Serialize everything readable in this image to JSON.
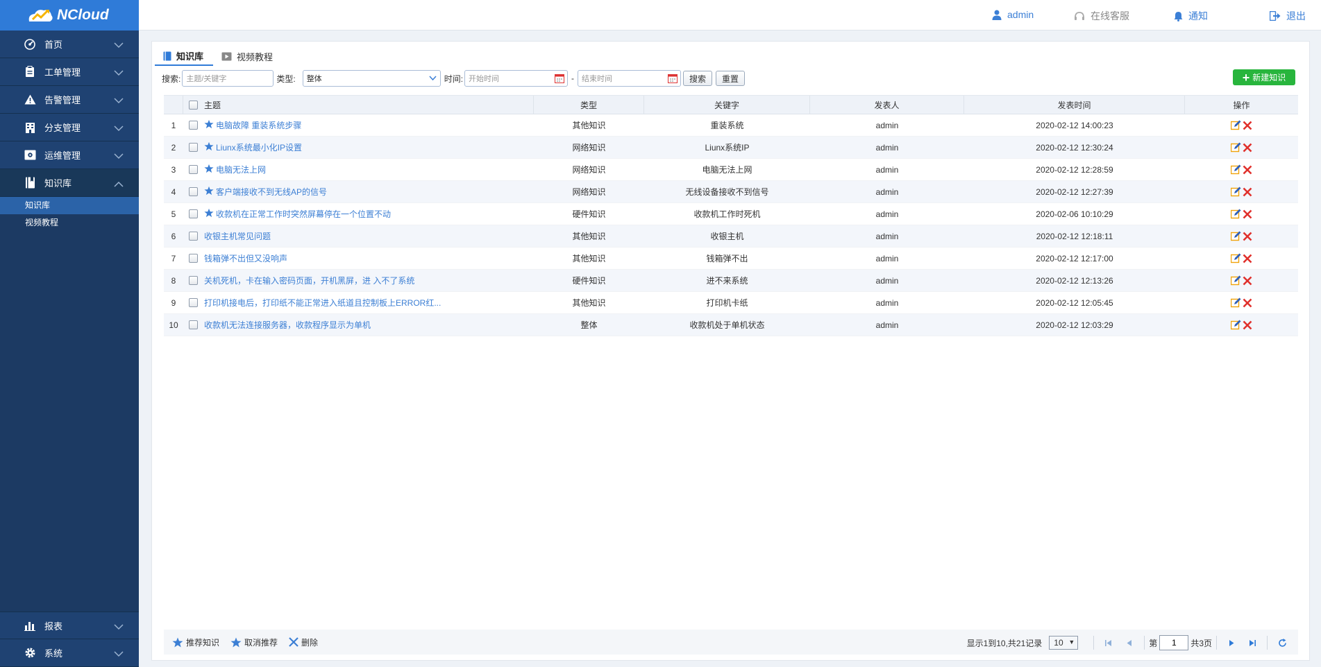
{
  "app": {
    "name": "NCloud"
  },
  "sidebar": {
    "items": [
      {
        "label": "首页",
        "icon": "dashboard-icon"
      },
      {
        "label": "工单管理",
        "icon": "clipboard-icon"
      },
      {
        "label": "告警管理",
        "icon": "warning-icon"
      },
      {
        "label": "分支管理",
        "icon": "building-icon"
      },
      {
        "label": "运维管理",
        "icon": "monitor-icon"
      },
      {
        "label": "知识库",
        "icon": "book-icon",
        "expanded": true
      }
    ],
    "sub_items": [
      {
        "label": "知识库",
        "active": true
      },
      {
        "label": "视频教程",
        "active": false
      }
    ],
    "bottom_items": [
      {
        "label": "报表",
        "icon": "chart-icon"
      },
      {
        "label": "系统",
        "icon": "gear-icon"
      }
    ]
  },
  "topbar": {
    "user": "admin",
    "support": "在线客服",
    "notify": "通知",
    "logout": "退出"
  },
  "tabs": [
    {
      "label": "知识库",
      "active": true
    },
    {
      "label": "视频教程",
      "active": false
    }
  ],
  "filters": {
    "search_label": "搜索:",
    "search_placeholder": "主题/关键字",
    "type_label": "类型:",
    "type_value": "整体",
    "time_label": "时间:",
    "start_placeholder": "开始时间",
    "dash": "-",
    "end_placeholder": "结束时间",
    "search_btn": "搜索",
    "reset_btn": "重置",
    "new_btn": "新建知识"
  },
  "table": {
    "columns": {
      "title": "主题",
      "type": "类型",
      "keyword": "关键字",
      "author": "发表人",
      "time": "发表时间",
      "ops": "操作"
    },
    "rows": [
      {
        "num": "1",
        "starred": true,
        "title": "电脑故障 重装系统步骤",
        "type": "其他知识",
        "keyword": "重装系统",
        "author": "admin",
        "time": "2020-02-12 14:00:23"
      },
      {
        "num": "2",
        "starred": true,
        "title": "Liunx系统最小化IP设置",
        "type": "网络知识",
        "keyword": "Liunx系统IP",
        "author": "admin",
        "time": "2020-02-12 12:30:24"
      },
      {
        "num": "3",
        "starred": true,
        "title": "电脑无法上网",
        "type": "网络知识",
        "keyword": "电脑无法上网",
        "author": "admin",
        "time": "2020-02-12 12:28:59"
      },
      {
        "num": "4",
        "starred": true,
        "title": "客户端接收不到无线AP的信号",
        "type": "网络知识",
        "keyword": "无线设备接收不到信号",
        "author": "admin",
        "time": "2020-02-12 12:27:39"
      },
      {
        "num": "5",
        "starred": true,
        "title": "收款机在正常工作时突然屏幕停在一个位置不动",
        "type": "硬件知识",
        "keyword": "收款机工作时死机",
        "author": "admin",
        "time": "2020-02-06 10:10:29"
      },
      {
        "num": "6",
        "starred": false,
        "title": "收银主机常见问题",
        "type": "其他知识",
        "keyword": "收银主机",
        "author": "admin",
        "time": "2020-02-12 12:18:11"
      },
      {
        "num": "7",
        "starred": false,
        "title": "钱箱弹不出但又没响声",
        "type": "其他知识",
        "keyword": "钱箱弹不出",
        "author": "admin",
        "time": "2020-02-12 12:17:00"
      },
      {
        "num": "8",
        "starred": false,
        "title": "关机死机，卡在输入密码页面，开机黑屏，进 入不了系统",
        "type": "硬件知识",
        "keyword": "进不来系统",
        "author": "admin",
        "time": "2020-02-12 12:13:26"
      },
      {
        "num": "9",
        "starred": false,
        "title": "打印机接电后，打印纸不能正常进入纸道且控制板上ERROR红...",
        "type": "其他知识",
        "keyword": "打印机卡纸",
        "author": "admin",
        "time": "2020-02-12 12:05:45"
      },
      {
        "num": "10",
        "starred": false,
        "title": "收款机无法连接服务器，收款程序显示为单机",
        "type": "整体",
        "keyword": "收款机处于单机状态",
        "author": "admin",
        "time": "2020-02-12 12:03:29"
      }
    ]
  },
  "footer": {
    "recommend": "推荐知识",
    "unrecommend": "取消推荐",
    "delete": "删除",
    "summary": "显示1到10,共21记录",
    "page_size": "10",
    "page_prefix": "第",
    "page_value": "1",
    "page_total": "共3页"
  },
  "colors": {
    "sidebar": "#1c3a63",
    "accent": "#2f7bd8",
    "link": "#3c7fd4",
    "new_button": "#28b53d",
    "delete": "#e0302c",
    "edit": "#f0a30a"
  }
}
